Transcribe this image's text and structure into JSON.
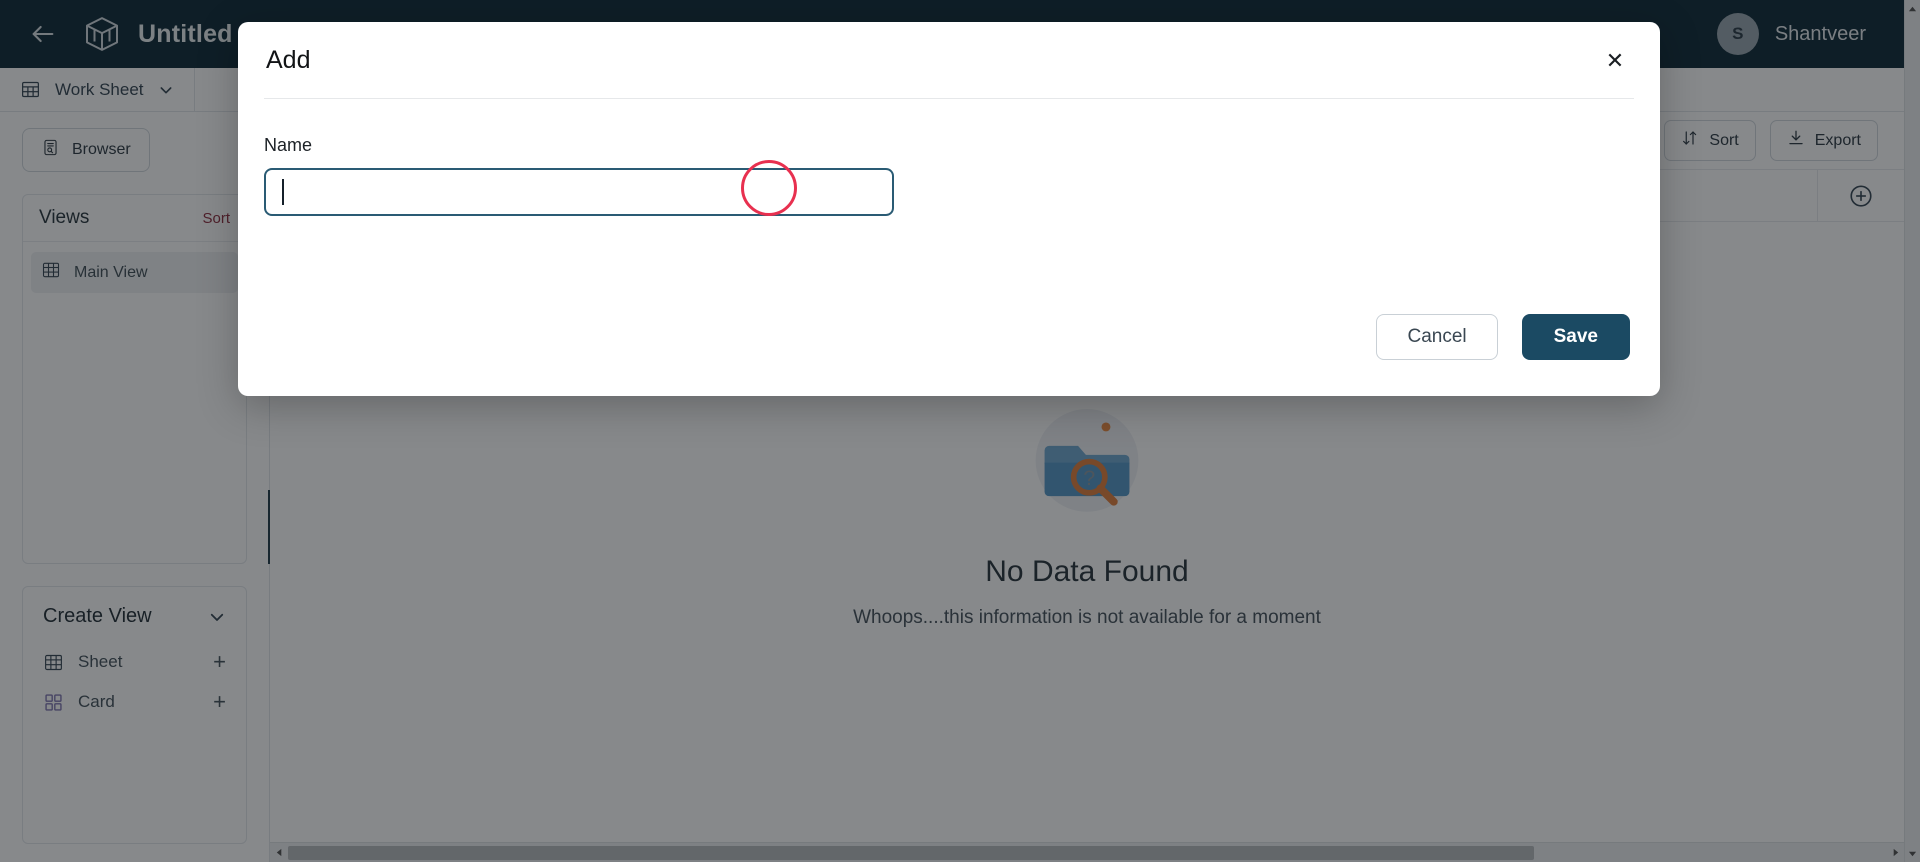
{
  "topbar": {
    "back_icon": "arrow-left-icon",
    "logo_icon": "cube-logo-icon",
    "title": "Untitled Sche",
    "user": {
      "initial": "S",
      "name": "Shantveer"
    }
  },
  "tabstrip": {
    "tab": {
      "label": "Work Sheet",
      "icon": "grid-icon",
      "chevron": "chevron-down-icon"
    }
  },
  "sidebar": {
    "browser_button": {
      "label": "Browser",
      "icon": "browser-icon"
    },
    "views": {
      "title": "Views",
      "sort_label": "Sort",
      "sort_color": "#8a2437",
      "items": [
        {
          "label": "Main View",
          "icon": "grid-icon"
        }
      ]
    },
    "create_view": {
      "title": "Create View",
      "chevron": "chevron-down-icon",
      "items": [
        {
          "label": "Sheet",
          "icon": "grid-icon",
          "add": "+"
        },
        {
          "label": "Card",
          "icon": "cards-icon",
          "add": "+"
        }
      ]
    },
    "collapse_handle_icon": "chevron-left-icon"
  },
  "content": {
    "toolbar": [
      {
        "label": "Sort",
        "icon": "sort-icon"
      },
      {
        "label": "Export",
        "icon": "download-icon"
      }
    ],
    "add_column_icon": "plus-circle-icon",
    "empty_state": {
      "illustration": "folder-search-icon",
      "title": "No Data Found",
      "subtitle": "Whoops....this information is not available for a moment"
    },
    "hscroll": {
      "left_arrow": "triangle-left-icon",
      "right_arrow": "triangle-right-icon"
    },
    "vscroll": {
      "up_arrow": "triangle-up-icon",
      "down_arrow": "triangle-down-icon"
    }
  },
  "modal": {
    "title": "Add",
    "close_icon": "close-icon",
    "name_field": {
      "label": "Name",
      "value": "",
      "placeholder": ""
    },
    "cancel_label": "Cancel",
    "save_label": "Save",
    "save_color": "#1b4a63"
  }
}
